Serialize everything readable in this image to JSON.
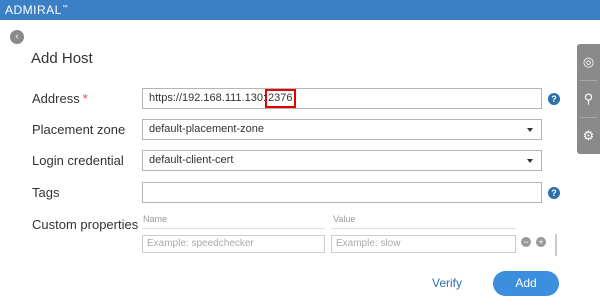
{
  "app": {
    "brand": "ADMIRAL",
    "trademark": "™"
  },
  "page": {
    "title": "Add Host",
    "back_icon": "back-arrow-icon"
  },
  "form": {
    "address": {
      "label": "Address",
      "required_mark": "*",
      "value_prefix": "https://192.168.111.130:",
      "value_port": "2376"
    },
    "placement_zone": {
      "label": "Placement zone",
      "value": "default-placement-zone"
    },
    "login_credential": {
      "label": "Login credential",
      "value": "default-client-cert"
    },
    "tags": {
      "label": "Tags",
      "value": ""
    },
    "custom_properties": {
      "label": "Custom properties",
      "name_header": "Name",
      "value_header": "Value",
      "name_placeholder": "Example: speedchecker",
      "value_placeholder": "Example: slow"
    },
    "help_glyph": "?"
  },
  "actions": {
    "verify": "Verify",
    "add": "Add"
  },
  "side_tabs": [
    "target-icon",
    "key-icon",
    "gear-icon"
  ],
  "colors": {
    "topbar": "#3b7fc4",
    "primary": "#3b8fdd",
    "link": "#2c6fab",
    "highlight": "#e00000",
    "required": "#d9534f"
  }
}
